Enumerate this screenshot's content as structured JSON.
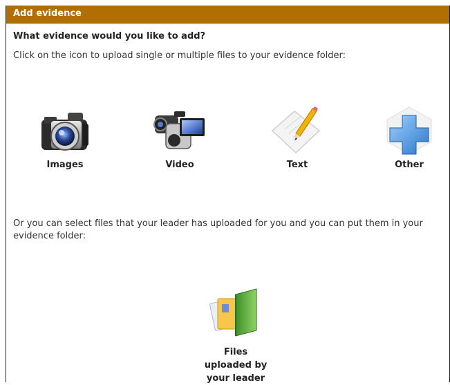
{
  "header": {
    "title": "Add evidence"
  },
  "main": {
    "question": "What evidence would you like to add?",
    "instruction": "Click on the icon to upload single or multiple files to your evidence folder:",
    "options": [
      {
        "label": "Images",
        "icon": "camera-icon"
      },
      {
        "label": "Video",
        "icon": "video-camera-icon"
      },
      {
        "label": "Text",
        "icon": "paper-pencil-icon"
      },
      {
        "label": "Other",
        "icon": "plus-icon"
      }
    ],
    "leader_instruction": "Or you can select files that your leader has uploaded for you and you can put them in your evidence folder:",
    "leader_files": {
      "label_lines": [
        "Files",
        "uploaded by",
        "your leader"
      ],
      "icon": "folder-files-icon"
    }
  },
  "colors": {
    "header_bg": "#b06f00",
    "header_text": "#ffffff"
  }
}
